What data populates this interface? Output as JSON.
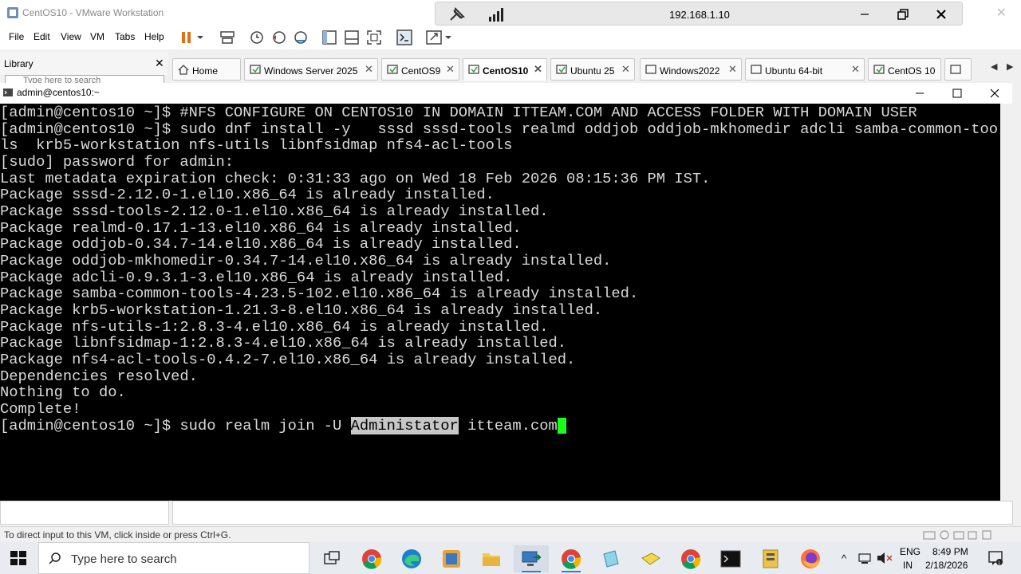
{
  "window": {
    "title": "CentOS10 - VMware Workstation"
  },
  "rdp": {
    "host": "192.168.1.10"
  },
  "menu": [
    "File",
    "Edit",
    "View",
    "VM",
    "Tabs",
    "Help"
  ],
  "library": {
    "title": "Library",
    "search_placeholder": "Type here to search"
  },
  "tabs": [
    {
      "label": "Home"
    },
    {
      "label": "Windows Server 2025"
    },
    {
      "label": "CentOS9"
    },
    {
      "label": "CentOS10",
      "active": true
    },
    {
      "label": "Ubuntu 25"
    },
    {
      "label": "Windows2022"
    },
    {
      "label": "Ubuntu 64-bit"
    },
    {
      "label": "CentOS 10"
    }
  ],
  "console": {
    "title": "admin@centos10:~"
  },
  "terminal": {
    "lines": [
      "[admin@centos10 ~]$ #NFS CONFIGURE ON CENTOS10 IN DOMAIN ITTEAM.COM AND ACCESS FOLDER WITH DOMAIN USER",
      "[admin@centos10 ~]$ sudo dnf install -y   sssd sssd-tools realmd oddjob oddjob-mkhomedir adcli samba-common-too",
      "ls  krb5-workstation nfs-utils libnfsidmap nfs4-acl-tools",
      "[sudo] password for admin:",
      "Last metadata expiration check: 0:31:33 ago on Wed 18 Feb 2026 08:15:36 PM IST.",
      "Package sssd-2.12.0-1.el10.x86_64 is already installed.",
      "Package sssd-tools-2.12.0-1.el10.x86_64 is already installed.",
      "Package realmd-0.17.1-13.el10.x86_64 is already installed.",
      "Package oddjob-0.34.7-14.el10.x86_64 is already installed.",
      "Package oddjob-mkhomedir-0.34.7-14.el10.x86_64 is already installed.",
      "Package adcli-0.9.3.1-3.el10.x86_64 is already installed.",
      "Package samba-common-tools-4.23.5-102.el10.x86_64 is already installed.",
      "Package krb5-workstation-1.21.3-8.el10.x86_64 is already installed.",
      "Package nfs-utils-1:2.8.3-4.el10.x86_64 is already installed.",
      "Package libnfsidmap-1:2.8.3-4.el10.x86_64 is already installed.",
      "Package nfs4-acl-tools-0.4.2-7.el10.x86_64 is already installed.",
      "Dependencies resolved.",
      "Nothing to do.",
      "Complete!"
    ],
    "prompt_prefix": "[admin@centos10 ~]$ sudo realm join -U ",
    "prompt_highlight": "Administator",
    "prompt_suffix": " itteam.com"
  },
  "status": {
    "text": "To direct input to this VM, click inside or press Ctrl+G."
  },
  "taskbar": {
    "search_placeholder": "Type here to search",
    "lang_top": "ENG",
    "lang_bottom": "IN",
    "time": "8:49 PM",
    "date": "2/18/2026"
  },
  "colors": {
    "terminal_bg": "#000000",
    "terminal_fg": "#d9d9d9",
    "cursor": "#19ff19",
    "accent": "#2a7de1"
  }
}
